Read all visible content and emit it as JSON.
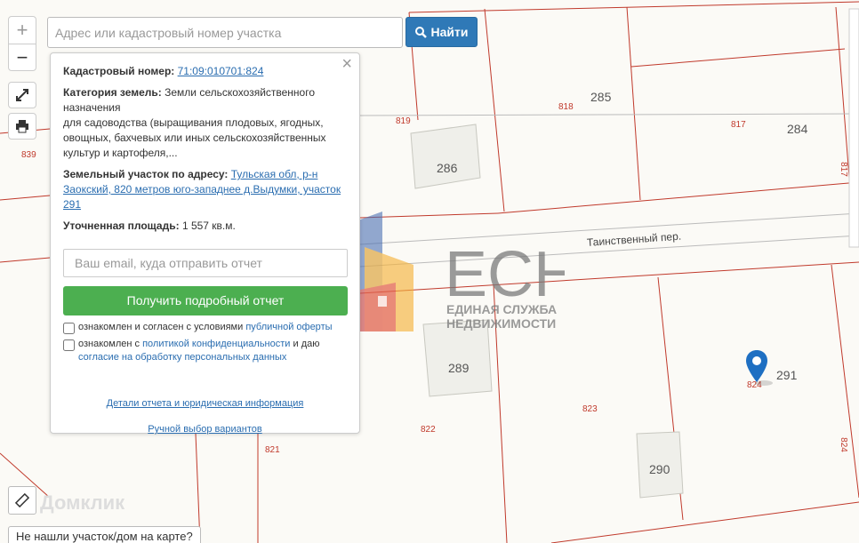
{
  "search": {
    "placeholder": "Адрес или кадастровый номер участка",
    "button_label": "Найти"
  },
  "controls": {
    "zoom_in": "+",
    "zoom_out": "−"
  },
  "popup": {
    "cadastral_label": "Кадастровый номер:",
    "cadastral_value": "71:09:010701:824",
    "category_label": "Категория земель:",
    "category_value": "Земли сельскохозяйственного назначения",
    "category_value2": "для садоводства (выращивания плодовых, ягодных, овощных, бахчевых или иных сельскохозяйственных культур и картофеля,...",
    "address_label": "Земельный участок по адресу:",
    "address_value": "Тульская обл, р-н Заокский, 820 метров юго-западнее д.Выдумки, участок 291",
    "area_label": "Уточненная площадь:",
    "area_value": "1 557 кв.м.",
    "email_placeholder": "Ваш email, куда отправить отчет",
    "report_button": "Получить подробный отчет",
    "agree1_text": "ознакомлен и согласен с условиями",
    "agree1_link": "публичной оферты",
    "agree2_text": "ознакомлен с",
    "agree2_link": "политикой конфиденциальности",
    "agree2_text2": "и даю",
    "agree2_link2": "согласие на обработку персональных данных",
    "details_link": "Детали отчета и юридическая информация",
    "manual_link": "Ручной выбор вариантов"
  },
  "watermark": {
    "brand": "ЕСН",
    "line1": "ЕДИНАЯ СЛУЖБА",
    "line2": "НЕДВИЖИМОСТИ"
  },
  "map": {
    "street": "Таинственный пер.",
    "plot_numbers": [
      "839",
      "819",
      "818",
      "817",
      "817",
      "821",
      "822",
      "823",
      "824",
      "824"
    ],
    "house_numbers": [
      "285",
      "284",
      "286",
      "289",
      "290",
      "291"
    ]
  },
  "footer": {
    "domclick": "Домклик",
    "not_found": "Не нашли участок/дом на карте?"
  },
  "colors": {
    "accent": "#2f79b7",
    "report_green": "#4caf50",
    "plot_line": "#c0392b",
    "pin": "#1e6fc2"
  }
}
